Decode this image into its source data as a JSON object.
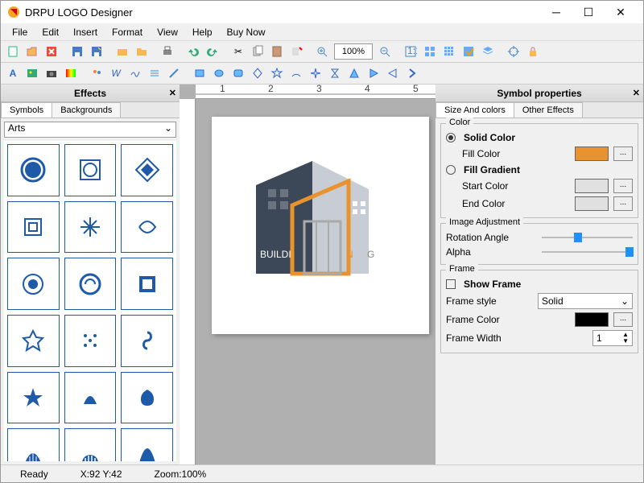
{
  "window": {
    "title": "DRPU LOGO Designer"
  },
  "menu": [
    "File",
    "Edit",
    "Insert",
    "Format",
    "View",
    "Help",
    "Buy Now"
  ],
  "toolbar": {
    "zoom_value": "100%"
  },
  "effects_panel": {
    "title": "Effects",
    "tabs": [
      "Symbols",
      "Backgrounds"
    ],
    "category": "Arts"
  },
  "canvas": {
    "logo_text": "BUILDING",
    "highlight_char": "N"
  },
  "props_panel": {
    "title": "Symbol properties",
    "tabs": [
      "Size And colors",
      "Other Effects"
    ],
    "color_group": "Color",
    "solid_label": "Solid Color",
    "fill_color_label": "Fill Color",
    "fill_color": "#e8932e",
    "gradient_label": "Fill Gradient",
    "start_color_label": "Start Color",
    "end_color_label": "End Color",
    "placeholder_color": "#e0e0e0",
    "adjust_group": "Image Adjustment",
    "rotation_label": "Rotation Angle",
    "alpha_label": "Alpha",
    "frame_group": "Frame",
    "show_frame_label": "Show Frame",
    "frame_style_label": "Frame style",
    "frame_style_value": "Solid",
    "frame_color_label": "Frame Color",
    "frame_color": "#000000",
    "frame_width_label": "Frame Width",
    "frame_width_value": "1"
  },
  "status": {
    "ready": "Ready",
    "coords": "X:92  Y:42",
    "zoom": "Zoom:100%"
  }
}
